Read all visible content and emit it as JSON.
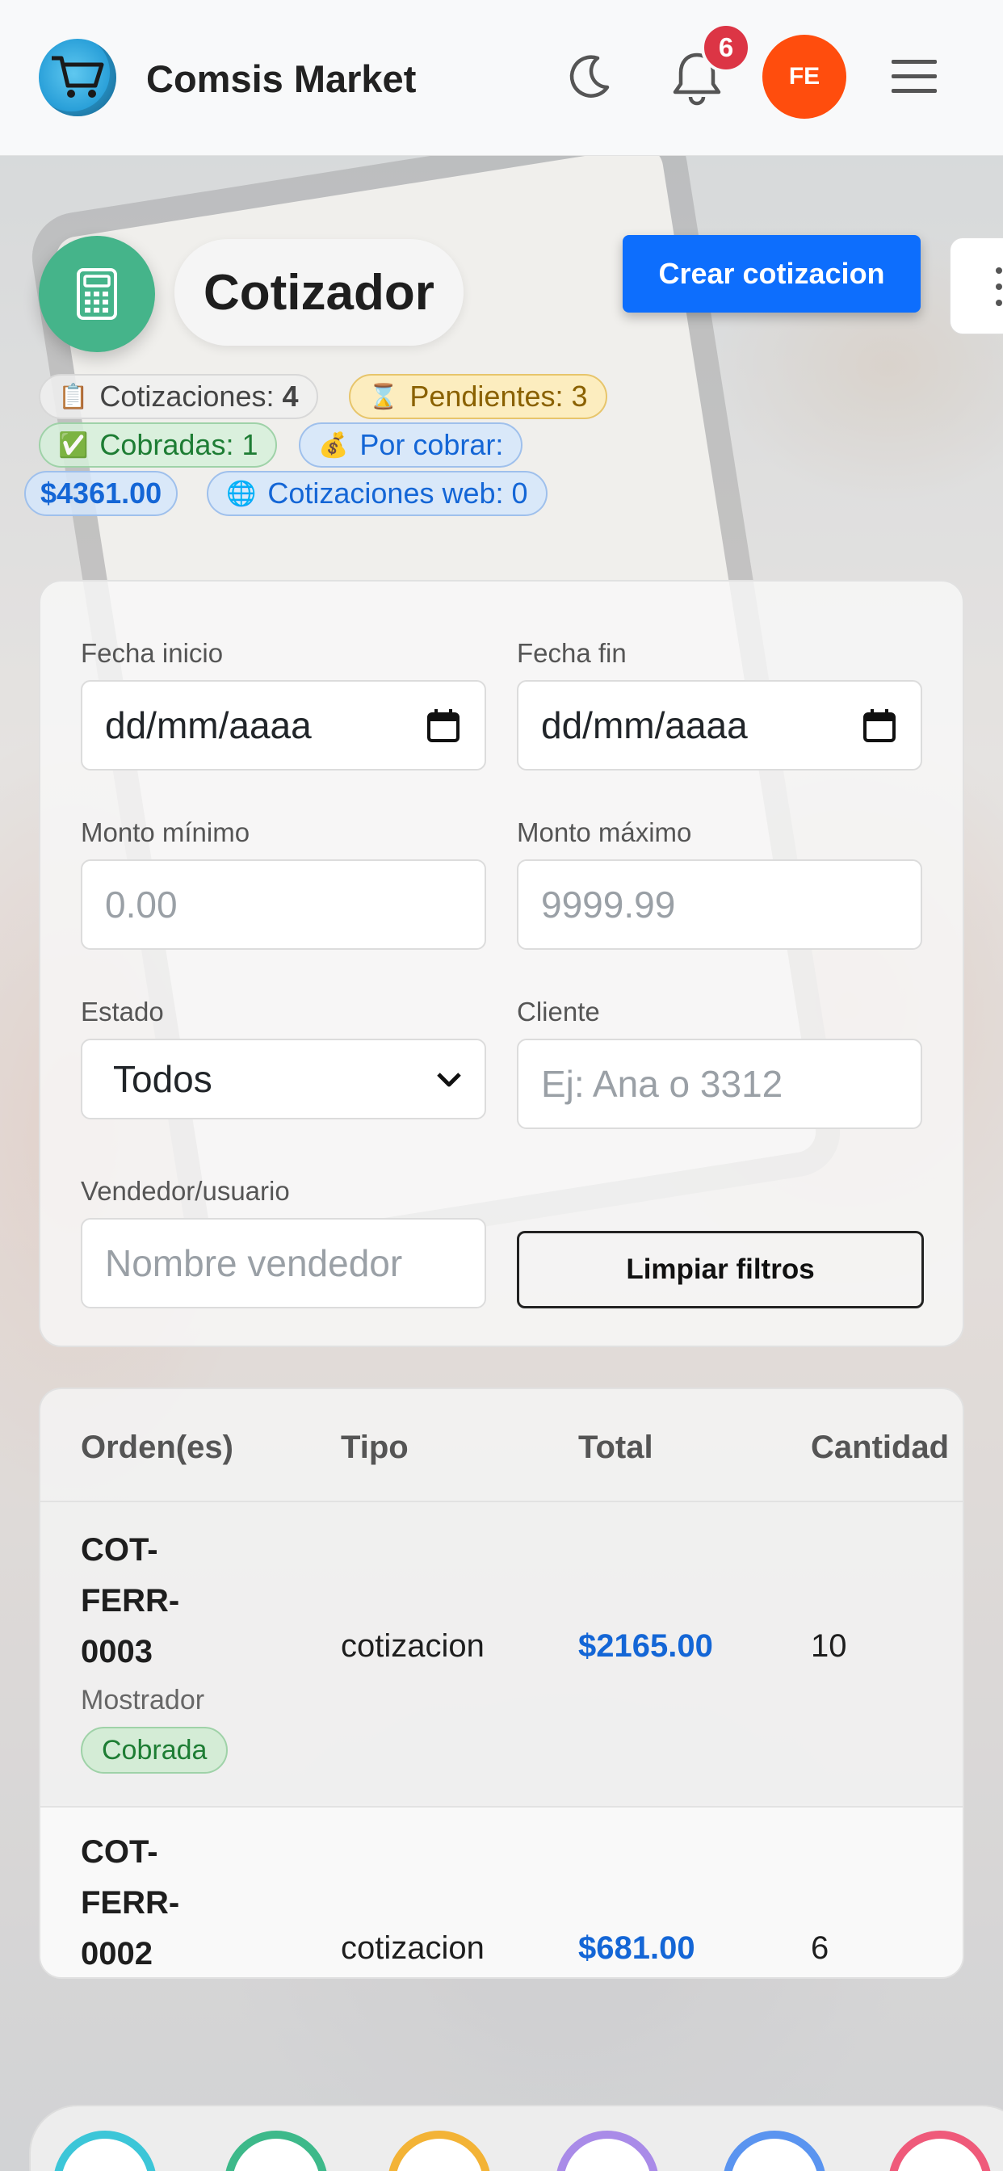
{
  "header": {
    "brand": "Comsis Market",
    "notifications_count": "6",
    "avatar_initials": "FE"
  },
  "page": {
    "title": "Cotizador",
    "create_button": "Crear cotizacion"
  },
  "stats": {
    "cotizaciones_label": "Cotizaciones:",
    "cotizaciones_value": "4",
    "pendientes_label": "Pendientes: 3",
    "cobradas_label": "Cobradas: 1",
    "por_cobrar_label": "Por cobrar:",
    "por_cobrar_value": "$4361.00",
    "web_label": "Cotizaciones web: 0"
  },
  "filters": {
    "fecha_inicio_label": "Fecha inicio",
    "fecha_inicio_value": "dd/mm/aaaa",
    "fecha_fin_label": "Fecha fin",
    "fecha_fin_value": "dd/mm/aaaa",
    "monto_min_label": "Monto mínimo",
    "monto_min_placeholder": "0.00",
    "monto_max_label": "Monto máximo",
    "monto_max_placeholder": "9999.99",
    "estado_label": "Estado",
    "estado_value": "Todos",
    "cliente_label": "Cliente",
    "cliente_placeholder": "Ej: Ana o 3312",
    "vendedor_label": "Vendedor/usuario",
    "vendedor_placeholder": "Nombre vendedor",
    "clear_button": "Limpiar filtros"
  },
  "table": {
    "columns": [
      "Orden(es)",
      "Tipo",
      "Total",
      "Cantidad"
    ],
    "rows": [
      {
        "order_lines": [
          "COT-",
          "FERR-",
          "0003"
        ],
        "origin": "Mostrador",
        "status": "Cobrada",
        "type": "cotizacion",
        "total": "$2165.00",
        "quantity": "10"
      },
      {
        "order_lines": [
          "COT-",
          "FERR-",
          "0002"
        ],
        "type": "cotizacion",
        "total": "$681.00",
        "quantity": "6"
      }
    ]
  },
  "colors": {
    "primary": "#0d6efd",
    "avatar": "#ff4d0d",
    "badge": "#dc3545",
    "page_icon": "#45b48a",
    "total_text": "#1466d6"
  },
  "icons": {
    "logo": "shopping-cart-icon",
    "theme": "moon-icon",
    "notifications": "bell-icon",
    "menu": "hamburger-icon",
    "page": "calculator-icon",
    "cotizaciones": "clipboard-icon",
    "pendientes": "hourglass-icon",
    "cobradas": "check-box-icon",
    "por_cobrar": "money-bag-icon",
    "web": "globe-icon"
  }
}
